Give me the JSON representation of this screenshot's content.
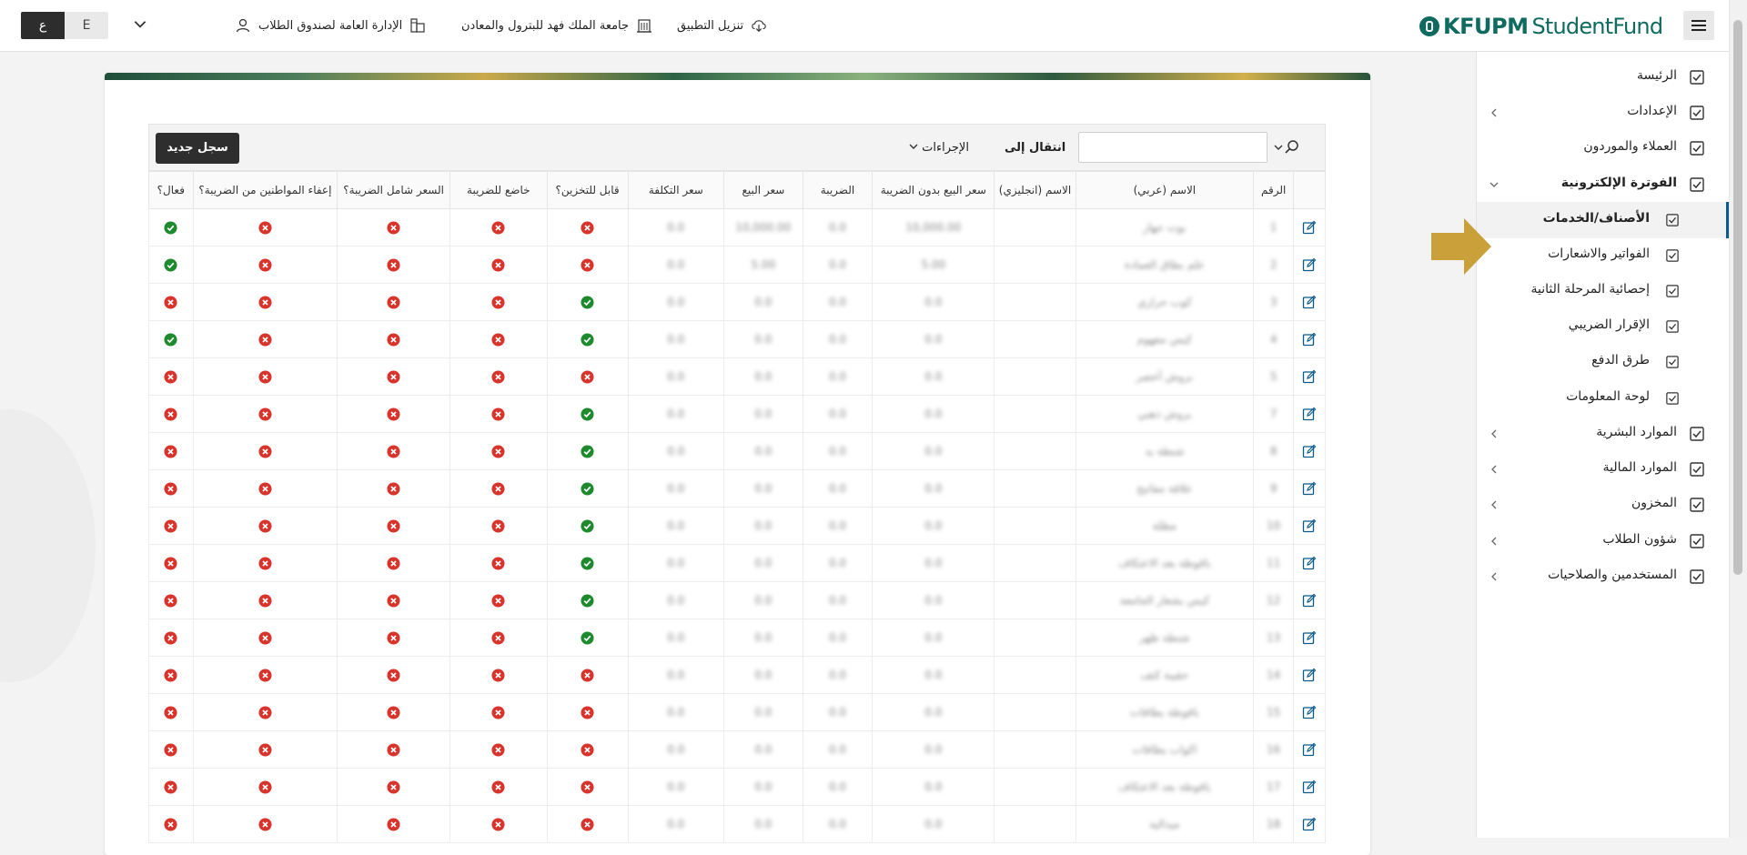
{
  "topbar": {
    "lang_ar": "ع",
    "lang_en": "E",
    "user_label": "الإدارة العامة لصندوق الطلاب",
    "university_label": "جامعة الملك فهد للبترول والمعادن",
    "download_label": "تنزيل التطبيق",
    "logo_kfupm": "KFUPM",
    "logo_fund": "StudentFund"
  },
  "sidebar": {
    "items": [
      {
        "label": "الرئيسة",
        "has_children": false
      },
      {
        "label": "الإعدادات",
        "has_children": true
      },
      {
        "label": "العملاء والموردون",
        "has_children": false
      },
      {
        "label": "الفوترة الإلكترونية",
        "has_children": true,
        "expanded": true
      },
      {
        "label": "الأصناف/الخدمات",
        "sub": true,
        "active": true
      },
      {
        "label": "الفواتير والاشعارات",
        "sub": true
      },
      {
        "label": "إحصائية المرحلة الثانية",
        "sub": true
      },
      {
        "label": "الإقرار الضريبي",
        "sub": true
      },
      {
        "label": "طرق الدفع",
        "sub": true
      },
      {
        "label": "لوحة المعلومات",
        "sub": true
      },
      {
        "label": "الموارد البشرية",
        "has_children": true
      },
      {
        "label": "الموارد المالية",
        "has_children": true
      },
      {
        "label": "المخزون",
        "has_children": true
      },
      {
        "label": "شؤون الطلاب",
        "has_children": true
      },
      {
        "label": "المستخدمين والصلاحيات",
        "has_children": true
      }
    ]
  },
  "toolbar": {
    "new_record": "سجل جديد",
    "actions": "الإجراءات",
    "goto": "انتقال إلى",
    "search_value": ""
  },
  "table": {
    "headers": [
      "الرقم",
      "الاسم (عربي)",
      "الاسم (انجليزي)",
      "سعر البيع بدون الضريبة",
      "الضريبة",
      "سعر البيع",
      "سعر التكلفة",
      "قابل للتخزين؟",
      "خاضع للضريبة",
      "السعر شامل الضريبة؟",
      "إعفاء المواطنين من الضريبة؟",
      "فعال؟"
    ],
    "rows": [
      {
        "num": "1",
        "name": "بوت جهاز",
        "en": "",
        "price_ex": "10,000.00",
        "tax": "0.0",
        "price": "10,000.00",
        "cost": "0.0",
        "storable": false,
        "taxable": false,
        "incl": false,
        "exempt": false,
        "active": true
      },
      {
        "num": "2",
        "name": "علم بطاق العمادة",
        "en": "",
        "price_ex": "5.00",
        "tax": "0.0",
        "price": "5.00",
        "cost": "0.0",
        "storable": false,
        "taxable": false,
        "incl": false,
        "exempt": false,
        "active": true
      },
      {
        "num": "3",
        "name": "كوب حراري",
        "en": "",
        "price_ex": "0.0",
        "tax": "0.0",
        "price": "0.0",
        "cost": "0.0",
        "storable": true,
        "taxable": false,
        "incl": false,
        "exempt": false,
        "active": false
      },
      {
        "num": "4",
        "name": "كيس مفهوم",
        "en": "",
        "price_ex": "0.0",
        "tax": "0.0",
        "price": "0.0",
        "cost": "0.0",
        "storable": true,
        "taxable": false,
        "incl": false,
        "exempt": false,
        "active": true
      },
      {
        "num": "5",
        "name": "بروش أخضر",
        "en": "",
        "price_ex": "0.0",
        "tax": "0.0",
        "price": "0.0",
        "cost": "0.0",
        "storable": false,
        "taxable": false,
        "incl": false,
        "exempt": false,
        "active": false
      },
      {
        "num": "7",
        "name": "بروش ذهبي",
        "en": "",
        "price_ex": "0.0",
        "tax": "0.0",
        "price": "0.0",
        "cost": "0.0",
        "storable": true,
        "taxable": false,
        "incl": false,
        "exempt": false,
        "active": false
      },
      {
        "num": "8",
        "name": "شنطة يد",
        "en": "",
        "price_ex": "0.0",
        "tax": "0.0",
        "price": "0.0",
        "cost": "0.0",
        "storable": true,
        "taxable": false,
        "incl": false,
        "exempt": false,
        "active": false
      },
      {
        "num": "9",
        "name": "علاقة مفاتيح",
        "en": "",
        "price_ex": "0.0",
        "tax": "0.0",
        "price": "0.0",
        "cost": "0.0",
        "storable": true,
        "taxable": false,
        "incl": false,
        "exempt": false,
        "active": false
      },
      {
        "num": "10",
        "name": "مظلة",
        "en": "",
        "price_ex": "0.0",
        "tax": "0.0",
        "price": "0.0",
        "cost": "0.0",
        "storable": true,
        "taxable": false,
        "incl": false,
        "exempt": false,
        "active": false
      },
      {
        "num": "11",
        "name": "باقوطة بعد الاعتكاف",
        "en": "",
        "price_ex": "0.0",
        "tax": "0.0",
        "price": "0.0",
        "cost": "0.0",
        "storable": true,
        "taxable": false,
        "incl": false,
        "exempt": false,
        "active": false
      },
      {
        "num": "12",
        "name": "كيس بشعار الجامعة",
        "en": "",
        "price_ex": "0.0",
        "tax": "0.0",
        "price": "0.0",
        "cost": "0.0",
        "storable": true,
        "taxable": false,
        "incl": false,
        "exempt": false,
        "active": false
      },
      {
        "num": "13",
        "name": "شنطة ظهر",
        "en": "",
        "price_ex": "0.0",
        "tax": "0.0",
        "price": "0.0",
        "cost": "0.0",
        "storable": true,
        "taxable": false,
        "incl": false,
        "exempt": false,
        "active": false
      },
      {
        "num": "14",
        "name": "حقيبة كتف",
        "en": "",
        "price_ex": "0.0",
        "tax": "0.0",
        "price": "0.0",
        "cost": "0.0",
        "storable": false,
        "taxable": false,
        "incl": false,
        "exempt": false,
        "active": false
      },
      {
        "num": "15",
        "name": "باقوطة بطاقات",
        "en": "",
        "price_ex": "0.0",
        "tax": "0.0",
        "price": "0.0",
        "cost": "0.0",
        "storable": false,
        "taxable": false,
        "incl": false,
        "exempt": false,
        "active": false
      },
      {
        "num": "16",
        "name": "اكواب بطاقات",
        "en": "",
        "price_ex": "0.0",
        "tax": "0.0",
        "price": "0.0",
        "cost": "0.0",
        "storable": false,
        "taxable": false,
        "incl": false,
        "exempt": false,
        "active": false
      },
      {
        "num": "17",
        "name": "باقوطة بعد الاعتكاف",
        "en": "",
        "price_ex": "0.0",
        "tax": "0.0",
        "price": "0.0",
        "cost": "0.0",
        "storable": false,
        "taxable": false,
        "incl": false,
        "exempt": false,
        "active": false
      },
      {
        "num": "18",
        "name": "ميدالية",
        "en": "",
        "price_ex": "0.0",
        "tax": "0.0",
        "price": "0.0",
        "cost": "0.0",
        "storable": false,
        "taxable": false,
        "incl": false,
        "exempt": false,
        "active": false
      }
    ]
  },
  "colors": {
    "yes": "#1e8a2e",
    "no": "#d9342b",
    "accent": "#0b5b8a",
    "brand": "#0f6b5f",
    "pointer": "#c9a03a"
  },
  "icons": [
    "hamburger-icon",
    "user-icon",
    "building-icon",
    "university-icon",
    "cloud-download-icon",
    "chevron-down-icon",
    "search-icon",
    "checkbox-icon",
    "edit-icon",
    "check-circle-icon",
    "x-circle-icon",
    "chevron-left-icon"
  ]
}
